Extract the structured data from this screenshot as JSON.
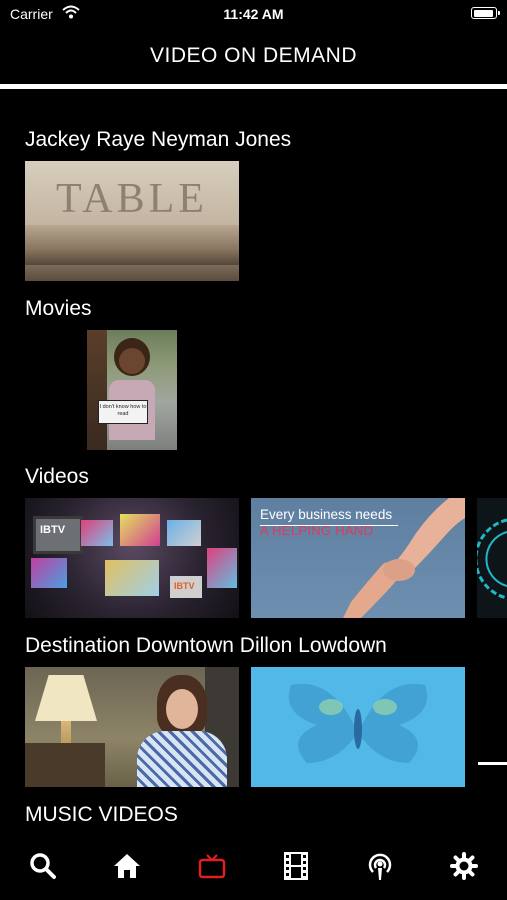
{
  "status": {
    "carrier": "Carrier",
    "time": "11:42 AM"
  },
  "nav": {
    "title": "VIDEO ON DEMAND"
  },
  "sections": [
    {
      "title": "Jackey Raye Neyman Jones",
      "items": [
        {
          "thumb_text": "TABLE"
        }
      ]
    },
    {
      "title": "Movies",
      "items": [
        {
          "sign_text": "I don't know how to read"
        }
      ]
    },
    {
      "title": "Videos",
      "items": [
        {
          "badge": "IBTV"
        },
        {
          "line1": "Every business needs",
          "line2": "A HELPING HAND"
        },
        {
          "kind": "circular-graphic"
        }
      ]
    },
    {
      "title": "Destination Downtown Dillon Lowdown",
      "items": [
        {
          "kind": "interview"
        },
        {
          "kind": "butterfly"
        }
      ]
    },
    {
      "title": "MUSIC VIDEOS",
      "items": []
    }
  ],
  "tabs": [
    {
      "name": "search",
      "icon": "search-icon",
      "active": false
    },
    {
      "name": "home",
      "icon": "home-icon",
      "active": false
    },
    {
      "name": "live-tv",
      "icon": "tv-icon",
      "active": true
    },
    {
      "name": "movies",
      "icon": "film-icon",
      "active": false
    },
    {
      "name": "podcasts",
      "icon": "podcast-icon",
      "active": false
    },
    {
      "name": "settings",
      "icon": "gear-icon",
      "active": false
    }
  ],
  "colors": {
    "background": "#000000",
    "active_tab": "#e02020",
    "text": "#ffffff"
  }
}
